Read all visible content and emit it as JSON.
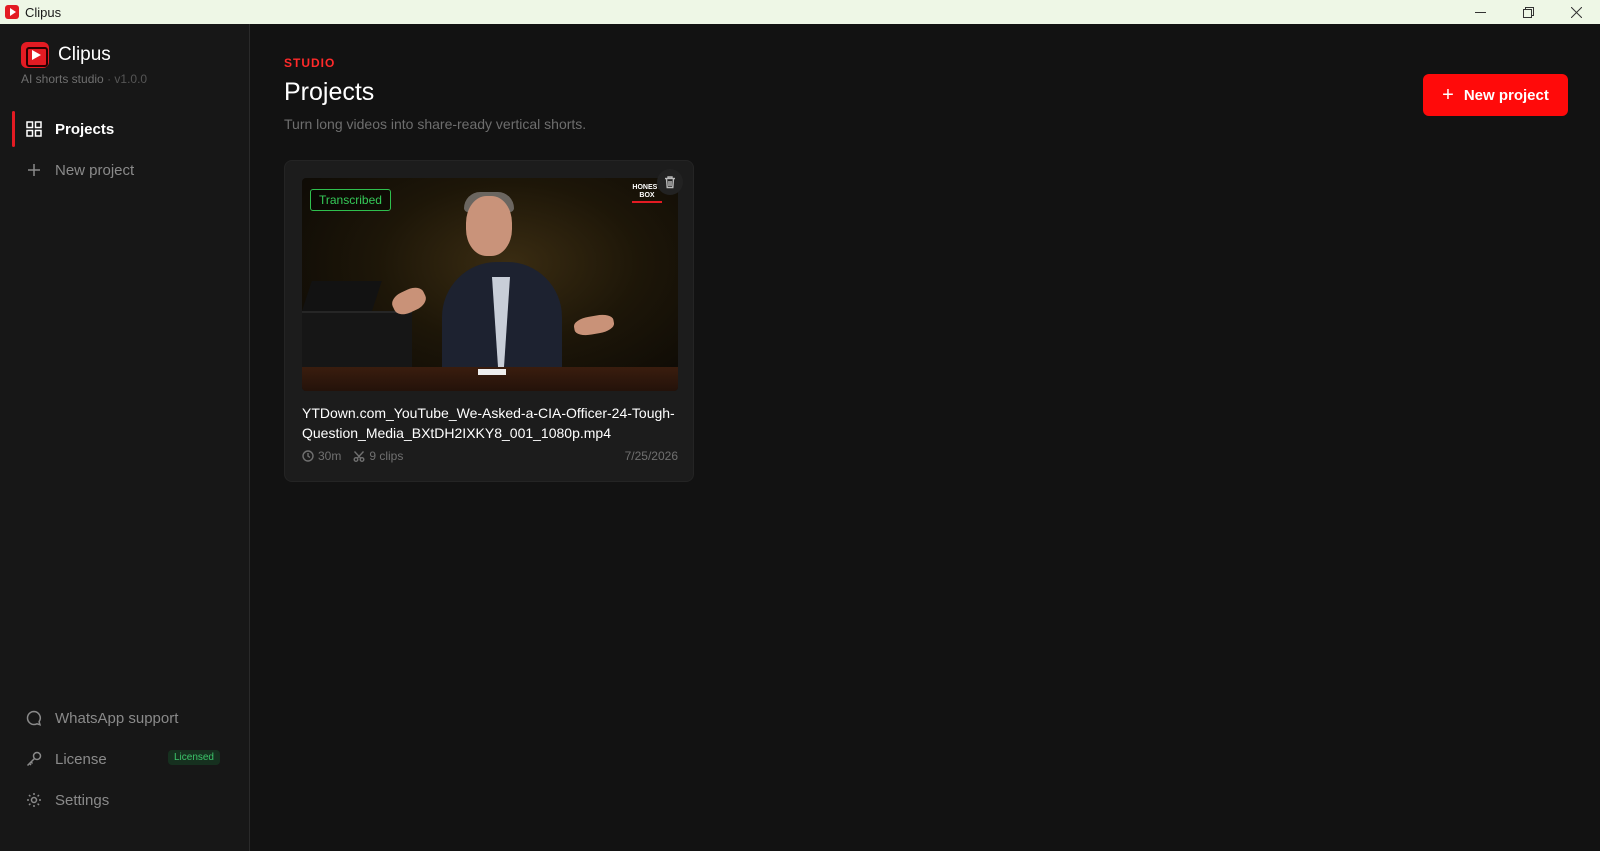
{
  "window": {
    "title": "Clipus",
    "controls": [
      "minimize",
      "restore",
      "close"
    ]
  },
  "sidebar": {
    "brand_name": "Clipus",
    "brand_sub": "AI shorts studio",
    "brand_version": "· v1.0.0",
    "nav": [
      {
        "label": "Projects",
        "icon": "grid-icon",
        "active": true
      },
      {
        "label": "New project",
        "icon": "plus-icon",
        "active": false
      }
    ],
    "footer": [
      {
        "label": "WhatsApp support",
        "icon": "chat-bubble-icon"
      },
      {
        "label": "License",
        "icon": "key-icon",
        "badge": "Licensed"
      },
      {
        "label": "Settings",
        "icon": "gear-icon"
      }
    ]
  },
  "main": {
    "eyebrow": "STUDIO",
    "title": "Projects",
    "subtitle": "Turn long videos into share-ready vertical shorts.",
    "new_project_label": "New project"
  },
  "projects": [
    {
      "status": "Transcribed",
      "filename": "YTDown.com_YouTube_We-Asked-a-CIA-Officer-24-Tough-Question_Media_BXtDH2IXKY8_001_1080p.mp4",
      "duration": "30m",
      "clips": "9 clips",
      "date": "7/25/2026",
      "watermark_line1": "HONEST",
      "watermark_line2": "BOX"
    }
  ],
  "colors": {
    "accent": "#ff0a0a",
    "status_green": "#35c958",
    "background": "#121212",
    "sidebar": "#171717"
  }
}
